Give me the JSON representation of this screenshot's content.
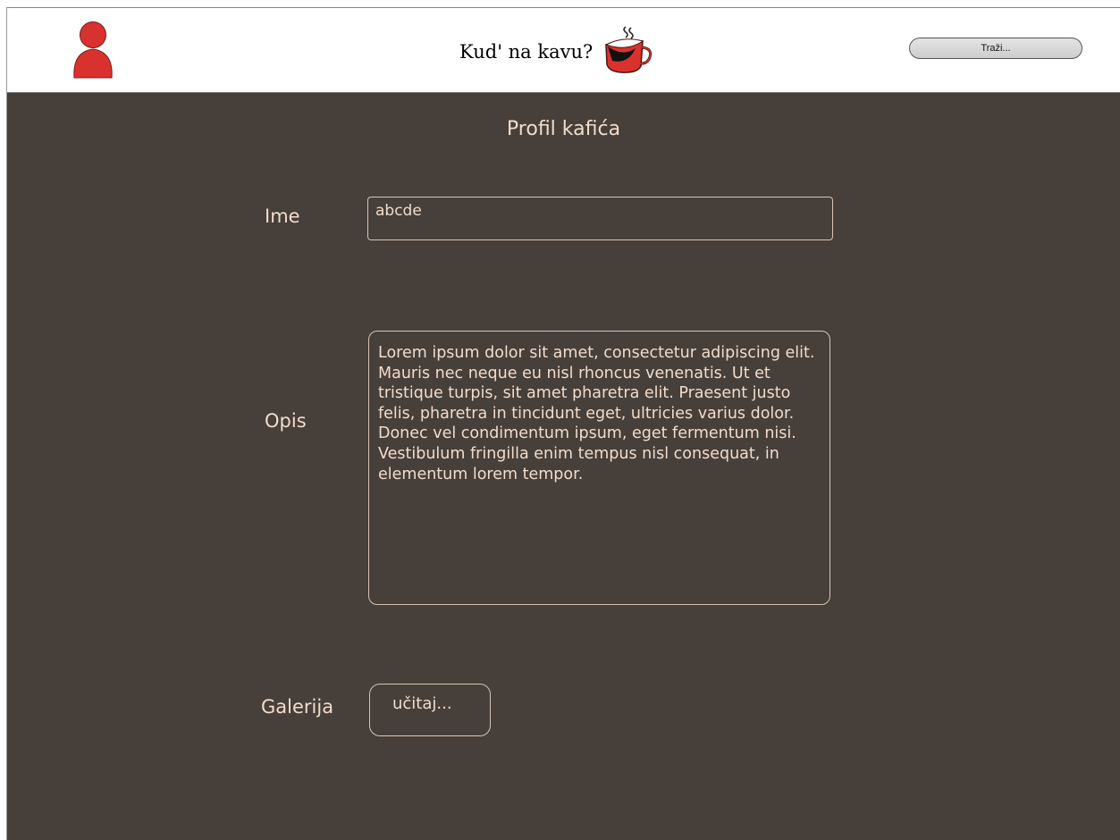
{
  "header": {
    "brand_title": "Kud' na kavu?",
    "search_label": "Traži..."
  },
  "page": {
    "title": "Profil kafića"
  },
  "form": {
    "name_label": "Ime",
    "name_value": "abcde",
    "description_label": "Opis",
    "description_value": "Lorem ipsum dolor sit amet, consectetur adipiscing elit. Mauris nec neque eu nisl rhoncus venenatis. Ut et tristique turpis, sit amet pharetra elit. Praesent justo felis, pharetra in tincidunt eget, ultricies varius dolor. Donec vel condimentum ipsum, eget fermentum nisi. Vestibulum fringilla enim tempus nisl consequat, in elementum lorem tempor.",
    "gallery_label": "Galerija",
    "upload_label": "učitaj..."
  },
  "colors": {
    "background": "#463f3a",
    "text": "#f2dccb",
    "accent_red": "#d9322e"
  },
  "icons": {
    "user": "user-icon",
    "cup": "coffee-cup-icon"
  }
}
